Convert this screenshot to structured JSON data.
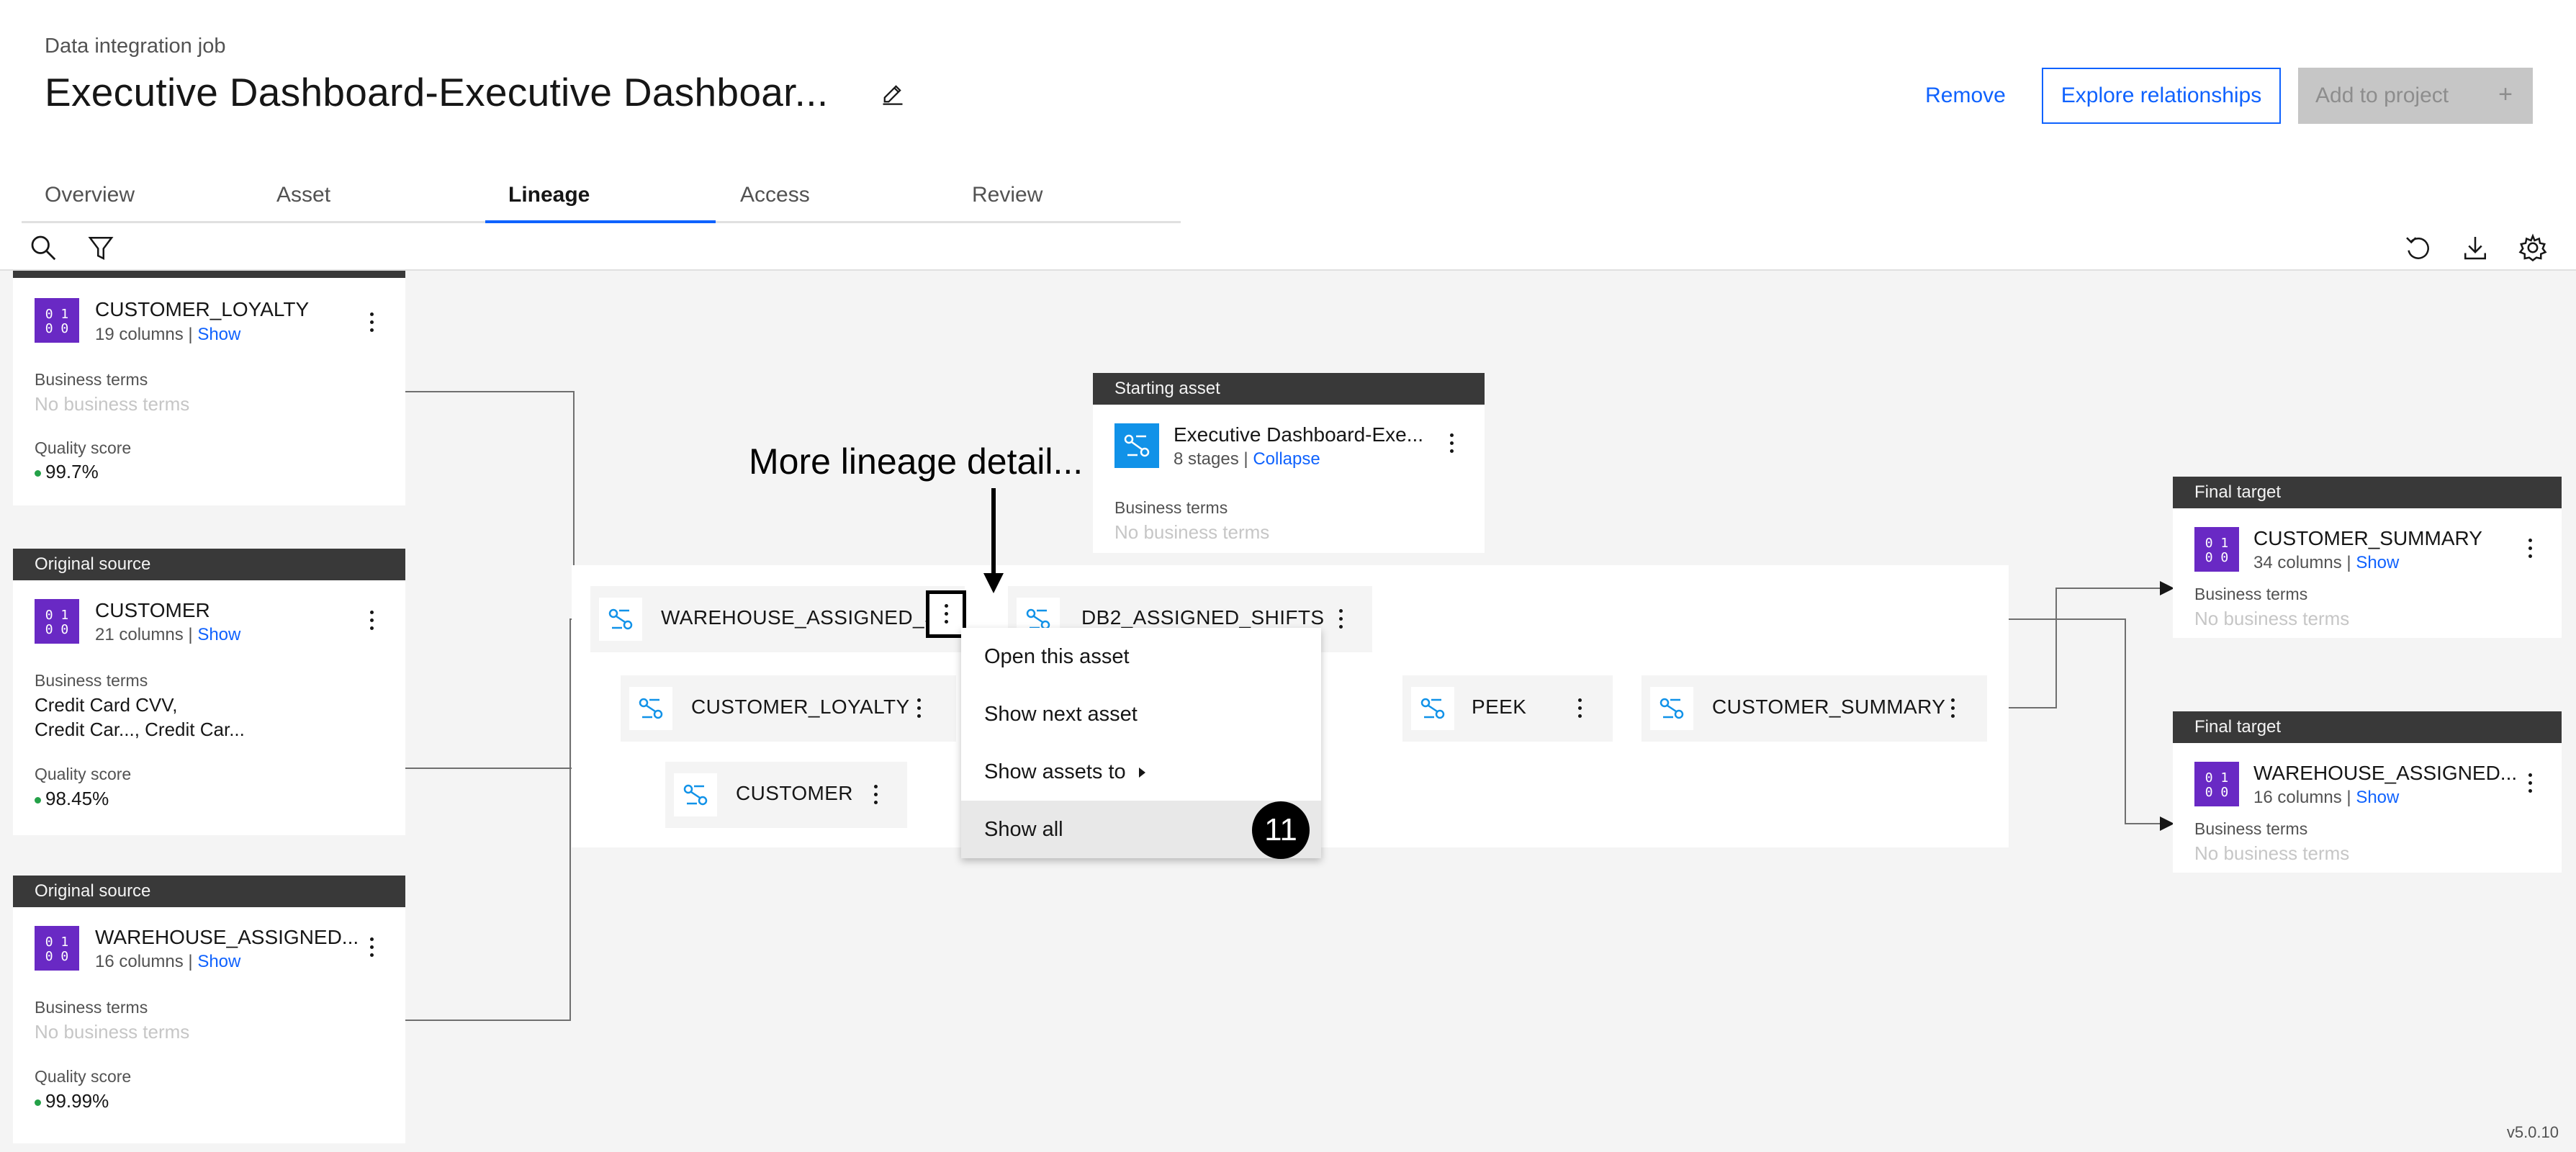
{
  "header": {
    "kicker": "Data integration job",
    "title": "Executive Dashboard-Executive Dashboar...",
    "edit_icon": "pencil-icon",
    "remove_label": "Remove",
    "explore_label": "Explore relationships",
    "add_label": "Add to project",
    "add_icon": "+"
  },
  "tabs": [
    {
      "label": "Overview"
    },
    {
      "label": "Asset"
    },
    {
      "label": "Lineage",
      "active": true
    },
    {
      "label": "Access"
    },
    {
      "label": "Review"
    }
  ],
  "toolbar": {
    "left_icons": [
      "search-icon",
      "filter-icon"
    ],
    "right_icons": [
      "reset-icon",
      "download-icon",
      "settings-icon"
    ]
  },
  "sources": [
    {
      "header": "",
      "name": "CUSTOMER_LOYALTY",
      "columns": "19 columns",
      "show": "Show",
      "bt_label": "Business terms",
      "bt_value": "No business terms",
      "qs_label": "Quality score",
      "qs_value": "99.7%"
    },
    {
      "header": "Original source",
      "name": "CUSTOMER",
      "columns": "21 columns",
      "show": "Show",
      "bt_label": "Business terms",
      "bt_value_1": "Credit Card CVV,",
      "bt_value_2": "Credit Car..., Credit Car...",
      "qs_label": "Quality score",
      "qs_value": "98.45%"
    },
    {
      "header": "Original source",
      "name": "WAREHOUSE_ASSIGNED...",
      "columns": "16 columns",
      "show": "Show",
      "bt_label": "Business terms",
      "bt_value": "No business terms",
      "qs_label": "Quality score",
      "qs_value": "99.99%"
    }
  ],
  "starting_asset": {
    "header": "Starting asset",
    "name": "Executive Dashboard-Exe...",
    "stages": "8 stages",
    "collapse": "Collapse",
    "bt_label": "Business terms",
    "bt_value": "No business terms"
  },
  "targets": [
    {
      "header": "Final target",
      "name": "CUSTOMER_SUMMARY",
      "columns": "34 columns",
      "show": "Show",
      "bt_label": "Business terms",
      "bt_value": "No business terms"
    },
    {
      "header": "Final target",
      "name": "WAREHOUSE_ASSIGNED...",
      "columns": "16 columns",
      "show": "Show",
      "bt_label": "Business terms",
      "bt_value": "No business terms"
    }
  ],
  "nodes": {
    "warehouse": "WAREHOUSE_ASSIGNED_S...",
    "db2": "DB2_ASSIGNED_SHIFTS",
    "loyalty": "CUSTOMER_LOYALTY",
    "customer": "CUSTOMER",
    "peek": "PEEK",
    "summary": "CUSTOMER_SUMMARY"
  },
  "context_menu": {
    "items": [
      "Open this asset",
      "Show next asset",
      "Show assets to",
      "Show all"
    ],
    "step_badge": "11"
  },
  "annotation": "More lineage detail...",
  "version": "v5.0.10",
  "colors": {
    "accent": "#0f62fe",
    "table_icon": "#6929c4",
    "job_icon": "#1192e8",
    "quality_dot": "#24a148"
  }
}
